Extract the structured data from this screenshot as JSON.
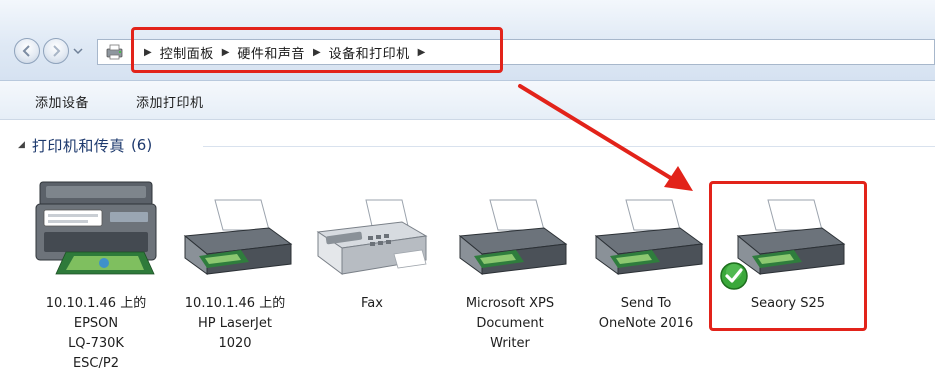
{
  "breadcrumb": [
    {
      "label": "控制面板"
    },
    {
      "label": "硬件和声音"
    },
    {
      "label": "设备和打印机"
    }
  ],
  "commands": {
    "add_device": "添加设备",
    "add_printer": "添加打印机"
  },
  "group": {
    "label": "打印机和传真",
    "count": "(6)"
  },
  "devices": [
    {
      "label_lines": [
        "10.10.1.46 上的",
        "EPSON",
        "LQ-730K",
        "ESC/P2"
      ],
      "icon": "multifunction-printer-icon",
      "is_default": false
    },
    {
      "label_lines": [
        "10.10.1.46 上的",
        "HP LaserJet",
        "1020"
      ],
      "icon": "printer-icon",
      "is_default": false
    },
    {
      "label_lines": [
        "Fax"
      ],
      "icon": "fax-icon",
      "is_default": false
    },
    {
      "label_lines": [
        "Microsoft XPS",
        "Document",
        "Writer"
      ],
      "icon": "printer-icon",
      "is_default": false
    },
    {
      "label_lines": [
        "Send To",
        "OneNote 2016"
      ],
      "icon": "printer-icon",
      "is_default": false
    },
    {
      "label_lines": [
        "Seaory S25"
      ],
      "icon": "printer-icon",
      "is_default": true
    }
  ],
  "colors": {
    "highlight": "#e2231a",
    "default_check": "#3aa83a",
    "group_text": "#1e3a6e"
  }
}
